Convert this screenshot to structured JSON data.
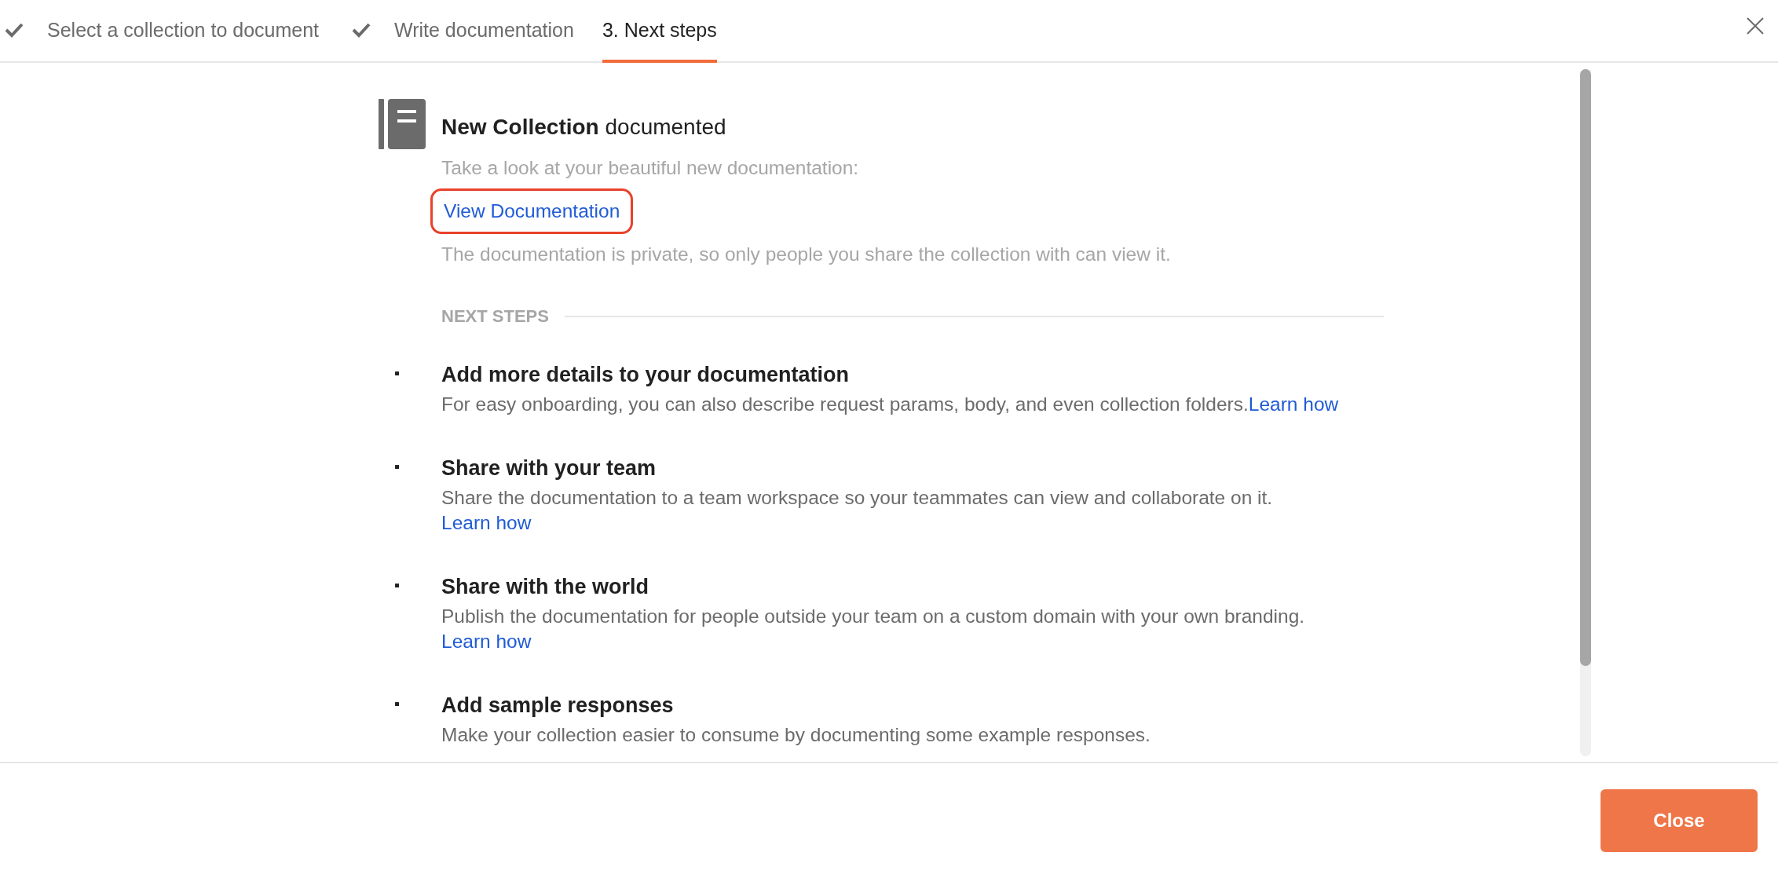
{
  "steps": [
    {
      "label": "Select a collection to document",
      "done": true,
      "selected": false
    },
    {
      "label": "Write documentation",
      "done": true,
      "selected": false
    },
    {
      "label": "3. Next steps",
      "done": false,
      "selected": true
    }
  ],
  "result": {
    "title": "**New Collection** documented",
    "intro": "Take a look at your beautiful new documentation:",
    "link": {
      "label": "View Documentation",
      "highlighted": true
    },
    "note": "The documentation is private, so only people you share the collection with can view it."
  },
  "next_steps": {
    "heading": "NEXT STEPS",
    "items": [
      {
        "bullet": "▪",
        "title": "Add more details to your documentation",
        "text": "For easy onboarding, you can also describe request params, body, and even collection folders.",
        "link": "Learn how",
        "link_inline": true
      },
      {
        "bullet": "▪",
        "title": "Share with your team",
        "text": "Share the documentation to a team workspace so your teammates can view and collaborate on it.",
        "link": "Learn how",
        "link_inline": false
      },
      {
        "bullet": "▪",
        "title": "Share with the world",
        "text": "Publish the documentation for people outside your team on a custom domain with your own branding.",
        "link": "Learn how",
        "link_inline": false
      },
      {
        "bullet": "▪",
        "title": "Add sample responses",
        "text": "Make your collection easier to consume by documenting some example responses."
      }
    ]
  },
  "footer": {
    "button": "Close"
  }
}
